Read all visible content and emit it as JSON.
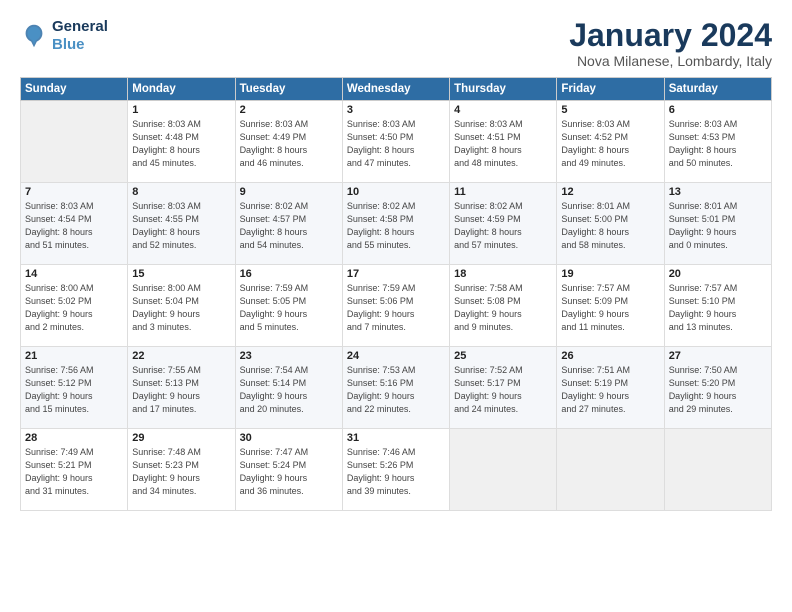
{
  "header": {
    "logo_line1": "General",
    "logo_line2": "Blue",
    "month": "January 2024",
    "location": "Nova Milanese, Lombardy, Italy"
  },
  "days_of_week": [
    "Sunday",
    "Monday",
    "Tuesday",
    "Wednesday",
    "Thursday",
    "Friday",
    "Saturday"
  ],
  "weeks": [
    [
      {
        "num": "",
        "info": ""
      },
      {
        "num": "1",
        "info": "Sunrise: 8:03 AM\nSunset: 4:48 PM\nDaylight: 8 hours\nand 45 minutes."
      },
      {
        "num": "2",
        "info": "Sunrise: 8:03 AM\nSunset: 4:49 PM\nDaylight: 8 hours\nand 46 minutes."
      },
      {
        "num": "3",
        "info": "Sunrise: 8:03 AM\nSunset: 4:50 PM\nDaylight: 8 hours\nand 47 minutes."
      },
      {
        "num": "4",
        "info": "Sunrise: 8:03 AM\nSunset: 4:51 PM\nDaylight: 8 hours\nand 48 minutes."
      },
      {
        "num": "5",
        "info": "Sunrise: 8:03 AM\nSunset: 4:52 PM\nDaylight: 8 hours\nand 49 minutes."
      },
      {
        "num": "6",
        "info": "Sunrise: 8:03 AM\nSunset: 4:53 PM\nDaylight: 8 hours\nand 50 minutes."
      }
    ],
    [
      {
        "num": "7",
        "info": "Sunrise: 8:03 AM\nSunset: 4:54 PM\nDaylight: 8 hours\nand 51 minutes."
      },
      {
        "num": "8",
        "info": "Sunrise: 8:03 AM\nSunset: 4:55 PM\nDaylight: 8 hours\nand 52 minutes."
      },
      {
        "num": "9",
        "info": "Sunrise: 8:02 AM\nSunset: 4:57 PM\nDaylight: 8 hours\nand 54 minutes."
      },
      {
        "num": "10",
        "info": "Sunrise: 8:02 AM\nSunset: 4:58 PM\nDaylight: 8 hours\nand 55 minutes."
      },
      {
        "num": "11",
        "info": "Sunrise: 8:02 AM\nSunset: 4:59 PM\nDaylight: 8 hours\nand 57 minutes."
      },
      {
        "num": "12",
        "info": "Sunrise: 8:01 AM\nSunset: 5:00 PM\nDaylight: 8 hours\nand 58 minutes."
      },
      {
        "num": "13",
        "info": "Sunrise: 8:01 AM\nSunset: 5:01 PM\nDaylight: 9 hours\nand 0 minutes."
      }
    ],
    [
      {
        "num": "14",
        "info": "Sunrise: 8:00 AM\nSunset: 5:02 PM\nDaylight: 9 hours\nand 2 minutes."
      },
      {
        "num": "15",
        "info": "Sunrise: 8:00 AM\nSunset: 5:04 PM\nDaylight: 9 hours\nand 3 minutes."
      },
      {
        "num": "16",
        "info": "Sunrise: 7:59 AM\nSunset: 5:05 PM\nDaylight: 9 hours\nand 5 minutes."
      },
      {
        "num": "17",
        "info": "Sunrise: 7:59 AM\nSunset: 5:06 PM\nDaylight: 9 hours\nand 7 minutes."
      },
      {
        "num": "18",
        "info": "Sunrise: 7:58 AM\nSunset: 5:08 PM\nDaylight: 9 hours\nand 9 minutes."
      },
      {
        "num": "19",
        "info": "Sunrise: 7:57 AM\nSunset: 5:09 PM\nDaylight: 9 hours\nand 11 minutes."
      },
      {
        "num": "20",
        "info": "Sunrise: 7:57 AM\nSunset: 5:10 PM\nDaylight: 9 hours\nand 13 minutes."
      }
    ],
    [
      {
        "num": "21",
        "info": "Sunrise: 7:56 AM\nSunset: 5:12 PM\nDaylight: 9 hours\nand 15 minutes."
      },
      {
        "num": "22",
        "info": "Sunrise: 7:55 AM\nSunset: 5:13 PM\nDaylight: 9 hours\nand 17 minutes."
      },
      {
        "num": "23",
        "info": "Sunrise: 7:54 AM\nSunset: 5:14 PM\nDaylight: 9 hours\nand 20 minutes."
      },
      {
        "num": "24",
        "info": "Sunrise: 7:53 AM\nSunset: 5:16 PM\nDaylight: 9 hours\nand 22 minutes."
      },
      {
        "num": "25",
        "info": "Sunrise: 7:52 AM\nSunset: 5:17 PM\nDaylight: 9 hours\nand 24 minutes."
      },
      {
        "num": "26",
        "info": "Sunrise: 7:51 AM\nSunset: 5:19 PM\nDaylight: 9 hours\nand 27 minutes."
      },
      {
        "num": "27",
        "info": "Sunrise: 7:50 AM\nSunset: 5:20 PM\nDaylight: 9 hours\nand 29 minutes."
      }
    ],
    [
      {
        "num": "28",
        "info": "Sunrise: 7:49 AM\nSunset: 5:21 PM\nDaylight: 9 hours\nand 31 minutes."
      },
      {
        "num": "29",
        "info": "Sunrise: 7:48 AM\nSunset: 5:23 PM\nDaylight: 9 hours\nand 34 minutes."
      },
      {
        "num": "30",
        "info": "Sunrise: 7:47 AM\nSunset: 5:24 PM\nDaylight: 9 hours\nand 36 minutes."
      },
      {
        "num": "31",
        "info": "Sunrise: 7:46 AM\nSunset: 5:26 PM\nDaylight: 9 hours\nand 39 minutes."
      },
      {
        "num": "",
        "info": ""
      },
      {
        "num": "",
        "info": ""
      },
      {
        "num": "",
        "info": ""
      }
    ]
  ]
}
